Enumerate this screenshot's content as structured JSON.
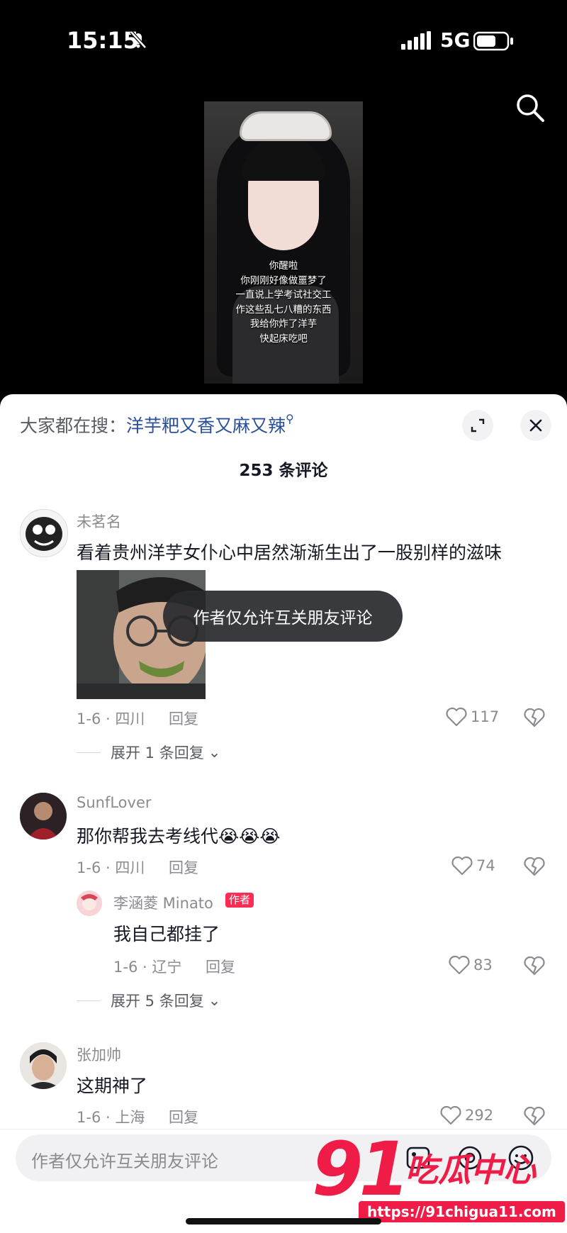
{
  "status_bar": {
    "time": "15:15",
    "network": "5G"
  },
  "video": {
    "subtitle_lines": [
      "你醒啦",
      "你刚刚好像做噩梦了",
      "一直说上学考试社交工",
      "作这些乱七八糟的东西",
      "我给你炸了洋芋",
      "快起床吃吧"
    ]
  },
  "sheet": {
    "hot_search_prefix": "大家都在搜：",
    "hot_search_keyword": "洋芋粑又香又麻又辣",
    "comment_count": "253 条评论"
  },
  "comments": [
    {
      "username": "未茗名",
      "text": "看着贵州洋芋女仆心中居然渐渐生出了一股别样的滋味",
      "date_loc": "1-6 · 四川",
      "reply": "回复",
      "likes": "117",
      "expand": "展开 1 条回复"
    },
    {
      "username": "SunfLover",
      "text": "那你帮我去考线代😭😭😭",
      "date_loc": "1-6 · 四川",
      "reply": "回复",
      "likes": "74"
    },
    {
      "username": "李涵菱 Minato",
      "badge": "作者",
      "text": "我自己都挂了",
      "date_loc": "1-6 · 辽宁",
      "reply": "回复",
      "likes": "83",
      "expand": "展开 5 条回复"
    },
    {
      "username": "张加帅",
      "text": "这期神了",
      "date_loc": "1-6 · 上海",
      "reply": "回复",
      "likes": "292"
    }
  ],
  "toast": "作者仅允许互关朋友评论",
  "input": {
    "placeholder": "作者仅允许互关朋友评论"
  },
  "watermark": {
    "number": "91",
    "name": "吃瓜中心",
    "url": "https://91chigua11.com"
  },
  "colors": {
    "accent": "#fe2c55",
    "link": "#2a4f9b",
    "watermark": "#ee1c47"
  }
}
